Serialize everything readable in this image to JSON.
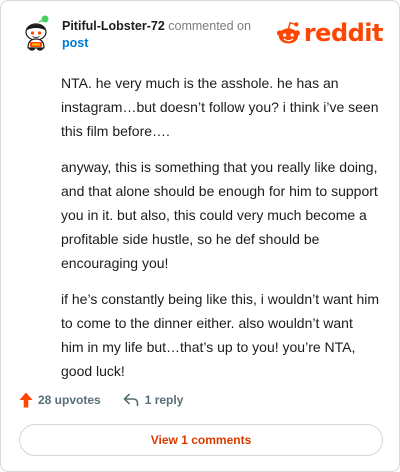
{
  "header": {
    "username": "Pitiful-Lobster-72",
    "commented_on": "commented on",
    "post_link": "post",
    "logo_text": "reddit"
  },
  "comment": {
    "paragraphs": [
      "NTA. he very much is the asshole. he has an instagram…but doesn’t follow you? i think i’ve seen this film before….",
      "anyway, this is something that you really like doing, and that alone should be enough for him to support you in it. but also, this could very much become a profitable side hustle, so he def should be encouraging you!",
      "if he’s constantly being like this, i wouldn’t want him to come to the dinner either. also wouldn’t want him in my life but…that’s up to you! you’re NTA, good luck!"
    ]
  },
  "actions": {
    "upvotes": "28 upvotes",
    "replies": "1 reply"
  },
  "footer": {
    "view_comments": "View 1 comments"
  },
  "colors": {
    "brand": "#ff4500",
    "link": "#0079d3",
    "upvote": "#ff4500",
    "view_button_text": "#d93a00"
  },
  "icons": {
    "avatar": "snoo-avatar-icon",
    "logo": "reddit-logo-icon",
    "upvote": "upvote-arrow-icon",
    "reply": "reply-arrow-icon"
  }
}
